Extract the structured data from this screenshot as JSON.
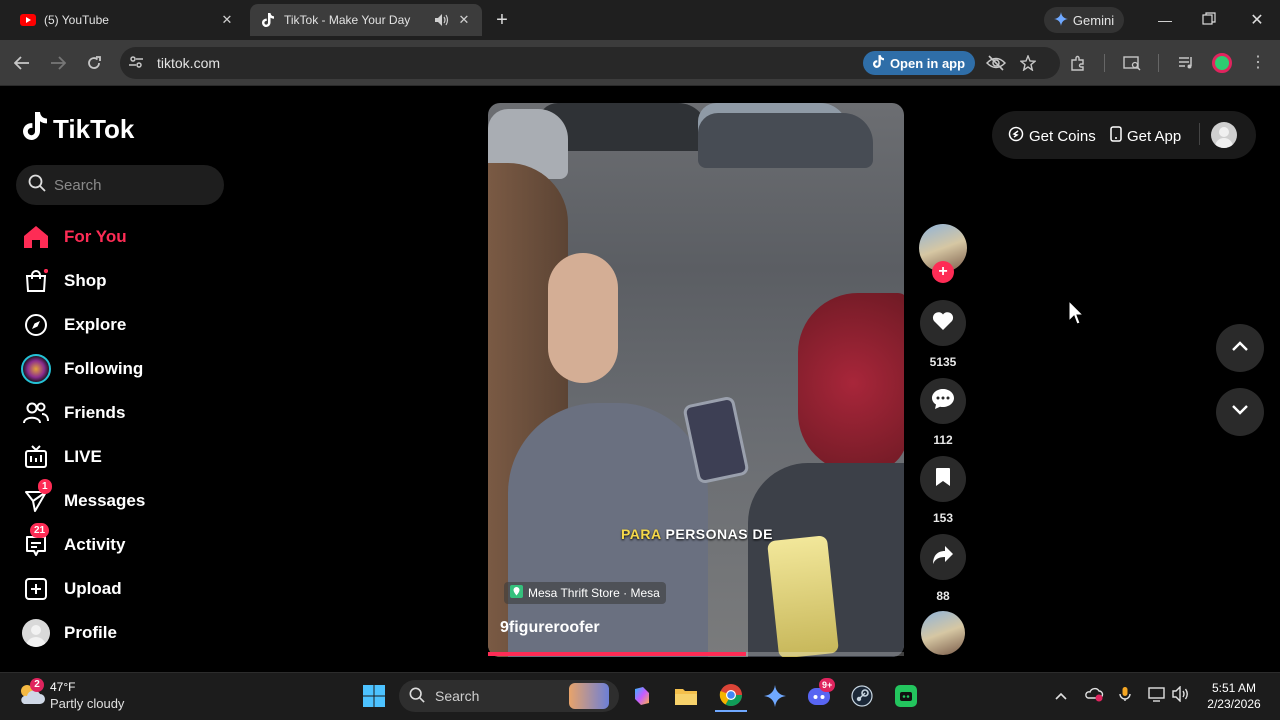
{
  "browser": {
    "tabs": [
      {
        "title": "(5) YouTube",
        "favicon": "youtube-icon"
      },
      {
        "title": "TikTok - Make Your Day",
        "favicon": "tiktok-icon",
        "active": true
      }
    ],
    "gemini_label": "Gemini",
    "url": "tiktok.com",
    "open_in_app_label": "Open in app"
  },
  "sidebar": {
    "logo_text": "TikTok",
    "search_placeholder": "Search",
    "items": [
      {
        "label": "For You",
        "icon": "home-icon",
        "active": true
      },
      {
        "label": "Shop",
        "icon": "shopping-bag-icon"
      },
      {
        "label": "Explore",
        "icon": "compass-icon"
      },
      {
        "label": "Following",
        "icon": "following-avatar"
      },
      {
        "label": "Friends",
        "icon": "friends-icon"
      },
      {
        "label": "LIVE",
        "icon": "live-tv-icon"
      },
      {
        "label": "Messages",
        "icon": "send-icon",
        "badge": "1"
      },
      {
        "label": "Activity",
        "icon": "inbox-icon",
        "badge": "21"
      },
      {
        "label": "Upload",
        "icon": "plus-square-icon"
      },
      {
        "label": "Profile",
        "icon": "profile-avatar"
      }
    ]
  },
  "video": {
    "caption_highlight": "PARA",
    "caption_rest": "PERSONAS DE",
    "location": "Mesa Thrift Store · Mesa",
    "author": "9figureroofer",
    "progress": 0.62
  },
  "actions": {
    "likes": "5135",
    "comments": "112",
    "bookmarks": "153",
    "shares": "88"
  },
  "header_right": {
    "get_coins": "Get Coins",
    "get_app": "Get App"
  },
  "taskbar": {
    "weather_temp": "47°F",
    "weather_desc": "Partly cloudy",
    "weather_badge": "2",
    "search_label": "Search",
    "discord_badge": "9+",
    "time": "5:51 AM",
    "date": "2/23/2026"
  },
  "colors": {
    "accent": "#fe2c55",
    "caption_highlight": "#f5d84a"
  }
}
